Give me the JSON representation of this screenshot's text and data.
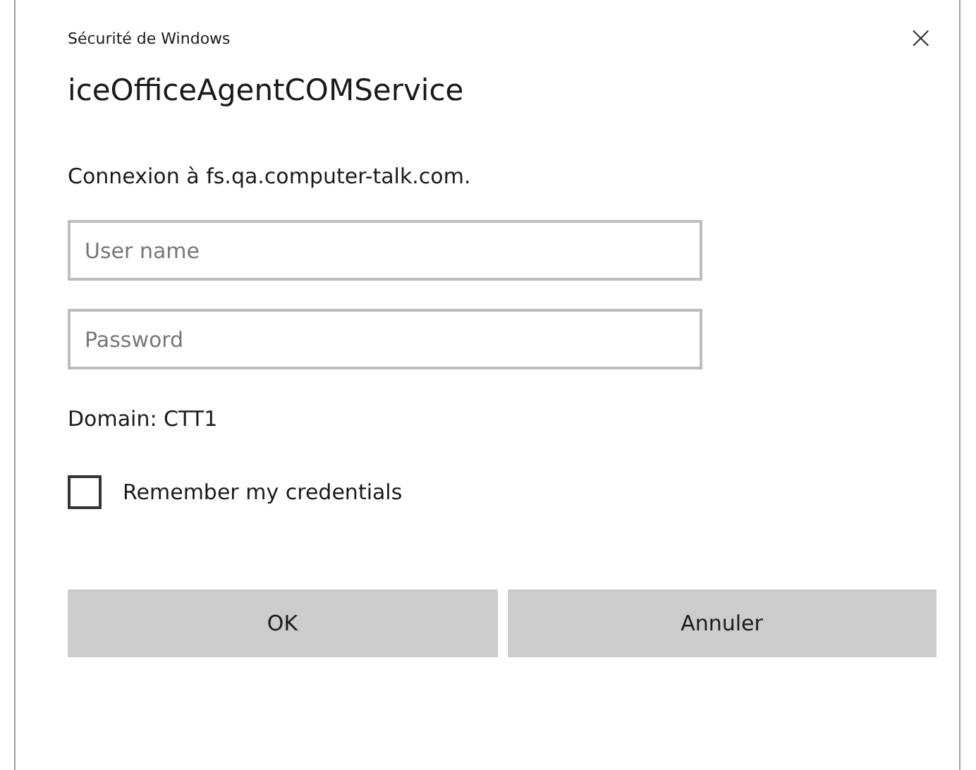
{
  "window": {
    "title": "Sécurité de Windows",
    "close": "×"
  },
  "heading": "iceOfficeAgentCOMService",
  "message": "Connexion à fs.qa.computer-talk.com.",
  "fields": [
    {
      "placeholder": "User name"
    },
    {
      "placeholder": "Password"
    }
  ],
  "domain": "Domain: CTT1",
  "remember": {
    "label": "Remember my credentials",
    "checked": false
  },
  "buttons": [
    "OK",
    "Annuler"
  ]
}
